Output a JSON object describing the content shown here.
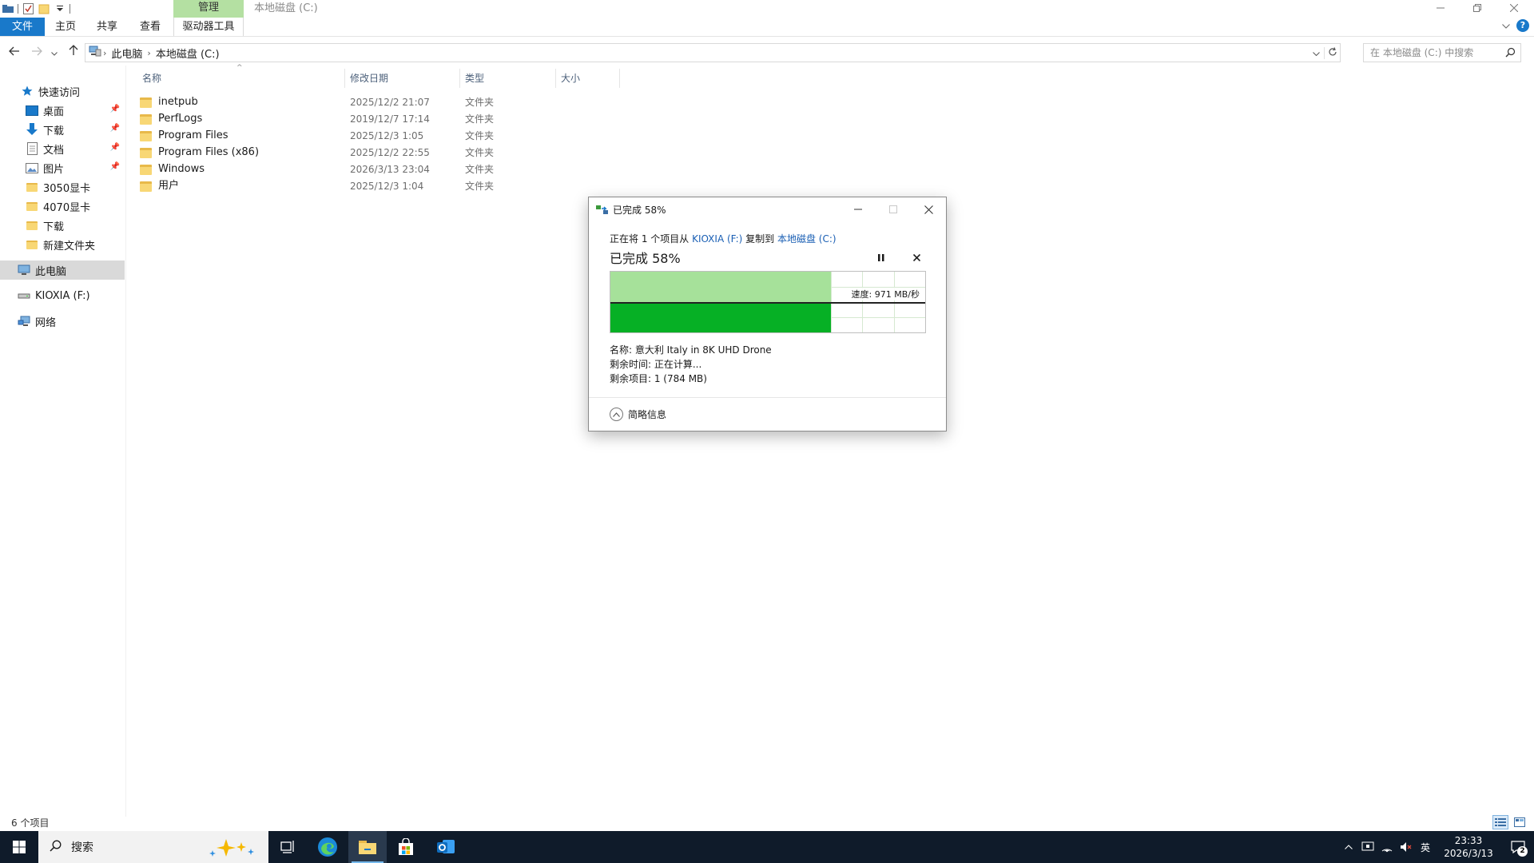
{
  "window": {
    "title": "本地磁盘 (C:)",
    "context_tab": "管理"
  },
  "ribbon": {
    "tabs": [
      {
        "label": "文件"
      },
      {
        "label": "主页"
      },
      {
        "label": "共享"
      },
      {
        "label": "查看"
      },
      {
        "label": "驱动器工具"
      }
    ]
  },
  "address": {
    "crumbs": [
      "此电脑",
      "本地磁盘 (C:)"
    ],
    "search_placeholder": "在 本地磁盘 (C:) 中搜索"
  },
  "nav": {
    "items": [
      {
        "label": "快速访问",
        "icon": "star-icon"
      },
      {
        "label": "桌面",
        "icon": "desktop-icon",
        "pinned": true
      },
      {
        "label": "下载",
        "icon": "download-icon",
        "pinned": true
      },
      {
        "label": "文档",
        "icon": "document-icon",
        "pinned": true
      },
      {
        "label": "图片",
        "icon": "picture-icon",
        "pinned": true
      },
      {
        "label": "3050显卡",
        "icon": "folder-icon"
      },
      {
        "label": "4070显卡",
        "icon": "folder-icon"
      },
      {
        "label": "下载",
        "icon": "folder-icon"
      },
      {
        "label": "新建文件夹",
        "icon": "folder-icon"
      },
      {
        "label": "此电脑",
        "icon": "computer-icon",
        "selected": true
      },
      {
        "label": "KIOXIA (F:)",
        "icon": "drive-icon"
      },
      {
        "label": "网络",
        "icon": "network-icon"
      }
    ]
  },
  "columns": {
    "name": "名称",
    "modified": "修改日期",
    "type": "类型",
    "size": "大小"
  },
  "files": [
    {
      "name": "inetpub",
      "modified": "2025/12/2 21:07",
      "type": "文件夹"
    },
    {
      "name": "PerfLogs",
      "modified": "2019/12/7 17:14",
      "type": "文件夹"
    },
    {
      "name": "Program Files",
      "modified": "2025/12/3 1:05",
      "type": "文件夹"
    },
    {
      "name": "Program Files (x86)",
      "modified": "2025/12/2 22:55",
      "type": "文件夹"
    },
    {
      "name": "Windows",
      "modified": "2026/3/13 23:04",
      "type": "文件夹"
    },
    {
      "name": "用户",
      "modified": "2025/12/3 1:04",
      "type": "文件夹"
    }
  ],
  "status": {
    "item_count": "6 个项目"
  },
  "dialog": {
    "title": "已完成 58%",
    "line_prefix": "正在将 1 个项目从 ",
    "source": "KIOXIA (F:)",
    "line_mid": " 复制到 ",
    "destination": "本地磁盘 (C:)",
    "heading": "已完成 58%",
    "progress_fraction": 0.7,
    "speed_label": "速度: 971 MB/秒",
    "details": {
      "name": "名称: 意大利 Italy in 8K UHD Drone",
      "time_remaining": "剩余时间: 正在计算...",
      "items_remaining": "剩余项目: 1 (784 MB)"
    },
    "fewer_details": "简略信息"
  },
  "taskbar": {
    "search_label": "搜索",
    "ime": "英",
    "time": "23:33",
    "date": "2026/3/13",
    "notification_count": "2"
  },
  "colors": {
    "accent": "#1979ca",
    "progress_fill": "#06b025",
    "progress_bg": "#a6e19a",
    "context_tab": "#b4e0a2",
    "link": "#1a5fb4"
  }
}
